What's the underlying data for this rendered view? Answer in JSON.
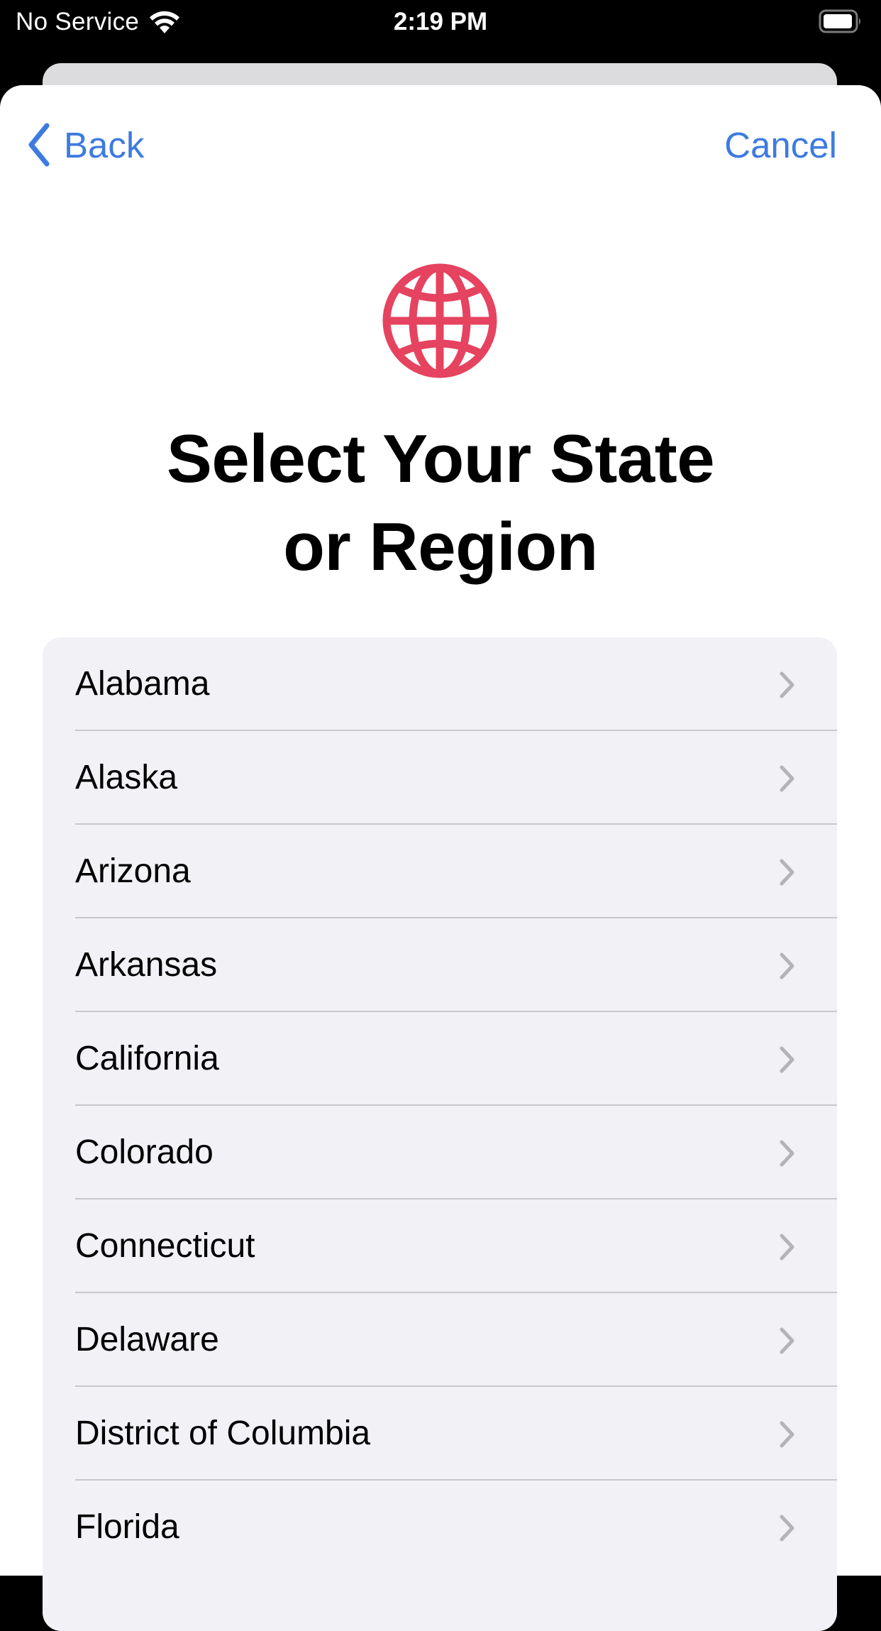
{
  "status_bar": {
    "carrier": "No Service",
    "time": "2:19 PM",
    "wifi_icon": "wifi-icon",
    "battery_icon": "battery-icon"
  },
  "nav": {
    "back_label": "Back",
    "cancel_label": "Cancel",
    "back_icon": "chevron-left-icon"
  },
  "header": {
    "icon": "globe-icon",
    "title_line1": "Select Your State",
    "title_line2": "or Region"
  },
  "colors": {
    "accent": "#3d7be0",
    "globe": "#e5435f",
    "list_background": "#f1f1f6",
    "separator": "#c8c8cc",
    "chevron": "#b4b4b8"
  },
  "regions": [
    {
      "label": "Alabama"
    },
    {
      "label": "Alaska"
    },
    {
      "label": "Arizona"
    },
    {
      "label": "Arkansas"
    },
    {
      "label": "California"
    },
    {
      "label": "Colorado"
    },
    {
      "label": "Connecticut"
    },
    {
      "label": "Delaware"
    },
    {
      "label": "District of Columbia"
    },
    {
      "label": "Florida"
    }
  ]
}
